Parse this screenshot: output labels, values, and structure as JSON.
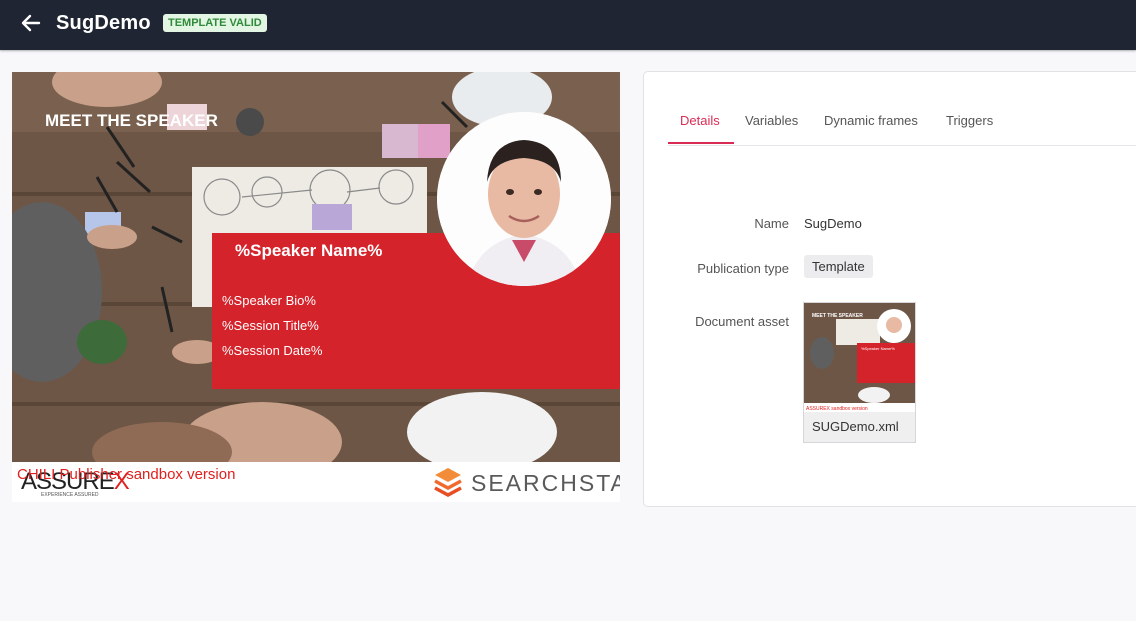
{
  "header": {
    "title": "SugDemo",
    "badge": "TEMPLATE VALID"
  },
  "preview": {
    "heading": "MEET THE SPEAKER",
    "speaker_name": "%Speaker Name%",
    "speaker_bio": "%Speaker Bio%",
    "session_title": "%Session Title%",
    "session_date": "%Session Date%",
    "brand_left": "ASSUREX",
    "brand_left_tagline": "EXPERIENCE ASSURED",
    "brand_right": "SEARCHSTAX",
    "watermark": "CHILI Publisher sandbox version"
  },
  "tabs": [
    {
      "label": "Details",
      "active": true
    },
    {
      "label": "Variables",
      "active": false
    },
    {
      "label": "Dynamic frames",
      "active": false
    },
    {
      "label": "Triggers",
      "active": false
    }
  ],
  "details": {
    "name_label": "Name",
    "name_value": "SugDemo",
    "pubtype_label": "Publication type",
    "pubtype_value": "Template",
    "asset_label": "Document asset",
    "asset_filename": "SUGDemo.xml"
  },
  "colors": {
    "topbar": "#1f2533",
    "accent": "#d92c55",
    "badge_bg": "#e3f5e3",
    "badge_fg": "#2f8a3a",
    "speaker_red": "#d5232b"
  },
  "icons": {
    "back": "arrow-left-icon"
  }
}
